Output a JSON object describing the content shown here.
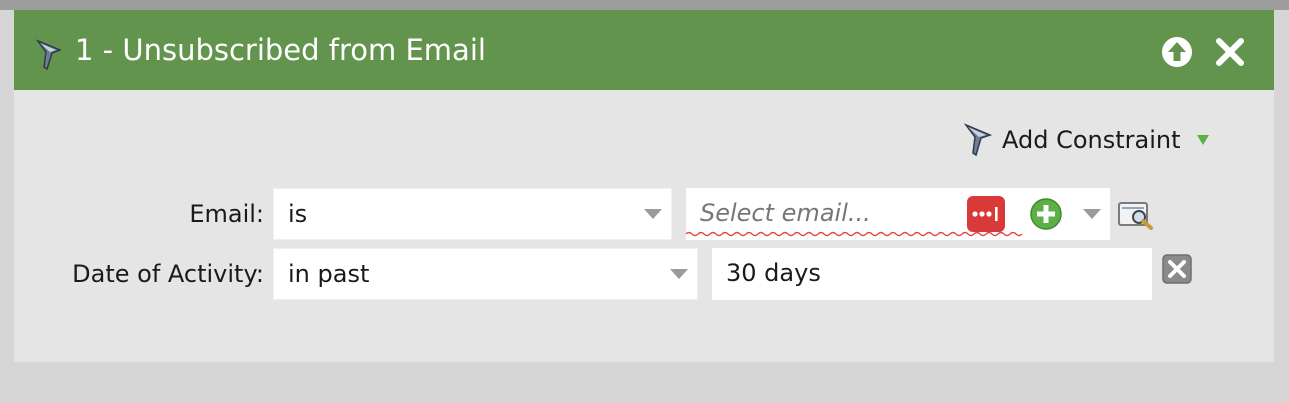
{
  "filter": {
    "title": "1 - Unsubscribed from Email"
  },
  "toolbar": {
    "add_constraint_label": "Add Constraint"
  },
  "rows": [
    {
      "label": "Email:",
      "operator": "is",
      "value_placeholder": "Select email..."
    },
    {
      "label": "Date of Activity:",
      "operator": "in past",
      "value": "30 days"
    }
  ],
  "icons": {
    "header_filter": "filter-funnel-icon",
    "move_up": "arrow-up-circle-icon",
    "close": "close-x-icon",
    "add_constraint": "filter-funnel-icon",
    "dropdown": "chevron-down-icon",
    "password_manager": "password-dots-icon",
    "add": "plus-circle-icon",
    "preview": "preview-magnifier-icon",
    "remove_constraint": "delete-x-box-icon"
  },
  "colors": {
    "header_bg": "#63944d",
    "panel_bg": "#e5e5e5",
    "page_bg": "#d6d6d6",
    "accent_green": "#5cb046",
    "password_red": "#d83a3a"
  }
}
